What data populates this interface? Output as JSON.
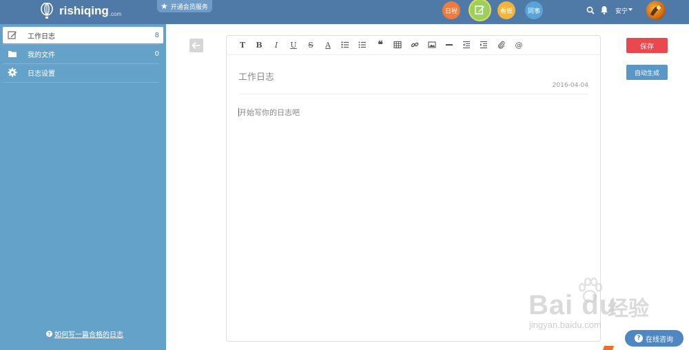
{
  "header": {
    "logo_text": "rishiqing",
    "logo_suffix": ".com",
    "vip_badge": "开通会员服务",
    "nav": [
      {
        "label": "日程",
        "color": "#ef7b3c"
      },
      {
        "label": "",
        "icon": "edit-icon",
        "color": "#9ad15a"
      },
      {
        "label": "看板",
        "color": "#f1b53a"
      },
      {
        "label": "同事",
        "color": "#5aa3d7"
      }
    ],
    "user_name": "安宁",
    "icons": [
      "search-icon",
      "bell-icon",
      "caret-down-icon",
      "avatar"
    ]
  },
  "sidebar": {
    "items": [
      {
        "label": "工作日志",
        "count": "8",
        "icon": "edit-icon",
        "active": true
      },
      {
        "label": "我的文件",
        "count": "0",
        "icon": "folder-icon",
        "active": false
      },
      {
        "label": "日志设置",
        "count": "",
        "icon": "gear-icon",
        "active": false
      }
    ],
    "help_link": "如何写一篇合格的日志",
    "bg_color": "#65a2c9"
  },
  "editor": {
    "toolbar": [
      "T",
      "B",
      "I",
      "U",
      "S",
      "A",
      "ordered-list-icon",
      "unordered-list-icon",
      "quote-icon",
      "table-icon",
      "link-icon",
      "image-icon",
      "hr-icon",
      "outdent-icon",
      "indent-icon",
      "attachment-icon",
      "at-icon"
    ],
    "title": "工作日志",
    "date": "2016-04-04",
    "placeholder": "开始写你的日志吧"
  },
  "actions": {
    "save_label": "保存",
    "save_color": "#e8484e",
    "auto_label": "自动生成",
    "auto_color": "#5a97c6"
  },
  "watermark": {
    "brand": "Bai du",
    "cn": "经验",
    "url": "jingyan.baidu.com"
  },
  "consult": {
    "label": "在线咨询"
  }
}
